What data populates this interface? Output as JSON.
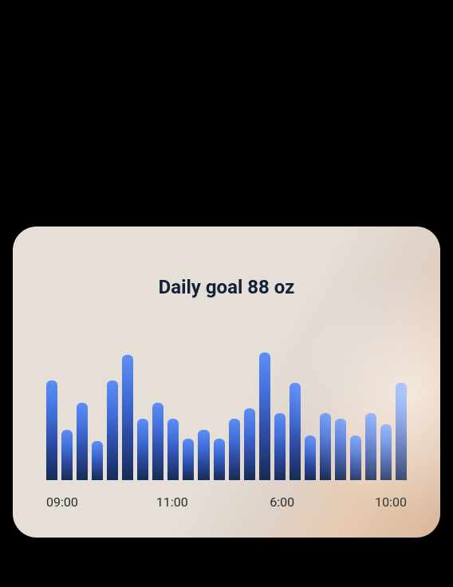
{
  "title": "Daily goal 88 oz",
  "chart_data": {
    "type": "bar",
    "title": "Daily goal 88 oz",
    "xlabel": "",
    "ylabel": "",
    "ylim": [
      0,
      100
    ],
    "x_tick_labels": [
      "09:00",
      "11:00",
      "6:00",
      "10:00"
    ],
    "x_tick_positions_pct": [
      0,
      30.5,
      62,
      96
    ],
    "values": [
      72,
      36,
      56,
      28,
      72,
      90,
      44,
      56,
      44,
      30,
      36,
      30,
      44,
      52,
      92,
      48,
      70,
      32,
      48,
      44,
      32,
      48,
      40,
      70
    ]
  }
}
